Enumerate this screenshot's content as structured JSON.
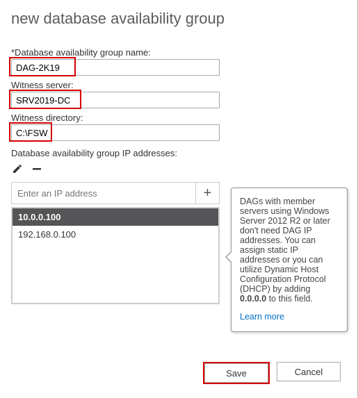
{
  "title": "new database availability group",
  "fields": {
    "dag_name_label": "*Database availability group name:",
    "dag_name_value": "DAG-2K19",
    "witness_server_label": "Witness server:",
    "witness_server_value": "SRV2019-DC",
    "witness_dir_label": "Witness directory:",
    "witness_dir_value": "C:\\FSW"
  },
  "ip_section": {
    "label": "Database availability group IP addresses:",
    "add_placeholder": "Enter an IP address",
    "items": [
      "10.0.0.100",
      "192.168.0.100"
    ],
    "selected_index": 0
  },
  "tooltip": {
    "text_pre": "DAGs with member servers using Windows Server 2012 R2 or later don't need DAG IP addresses. You can assign static IP addresses or you can utilize Dynamic Host Configuration Protocol (DHCP) by adding ",
    "bold": "0.0.0.0",
    "text_post": " to this field.",
    "learn": "Learn more"
  },
  "buttons": {
    "save": "Save",
    "cancel": "Cancel"
  },
  "icons": {
    "edit": "edit-icon",
    "remove": "remove-icon",
    "add": "add-icon"
  }
}
